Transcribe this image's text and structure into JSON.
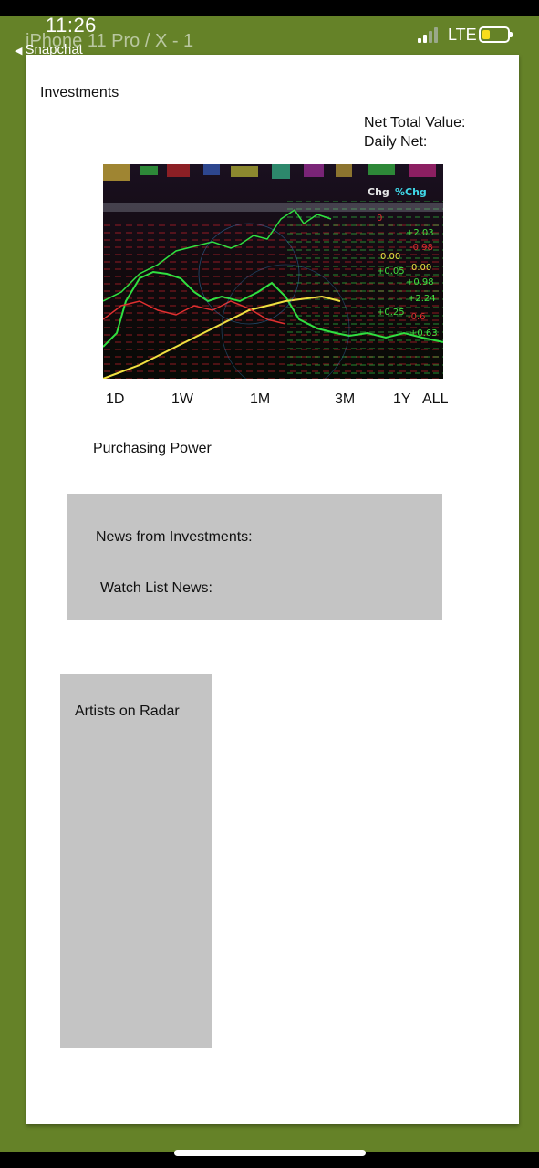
{
  "status_bar": {
    "time": "11:26",
    "network": "LTE",
    "signal_bars_active": 2,
    "signal_bars_total": 4,
    "battery_level": 0.25,
    "battery_color": "#f7dc1b"
  },
  "header": {
    "artboard_title": "iPhone 11 Pro / X - 1",
    "back_label": "Snapchat"
  },
  "colors": {
    "background": "#658228",
    "card": "#ffffff",
    "panel": "#c4c4c4"
  },
  "page": {
    "investments_label": "Investments",
    "net_total_label": "Net Total Value:",
    "daily_net_label": "Daily Net:",
    "chart_image": "stock-market-ticker-image",
    "ranges": [
      "1D",
      "1W",
      "1M",
      "3M",
      "1Y",
      "ALL"
    ],
    "purchasing_power_label": "Purchasing Power",
    "news_from_investments_label": "News from Investments:",
    "watch_list_news_label": "Watch List News:",
    "artists_on_radar_label": "Artists on Radar"
  }
}
